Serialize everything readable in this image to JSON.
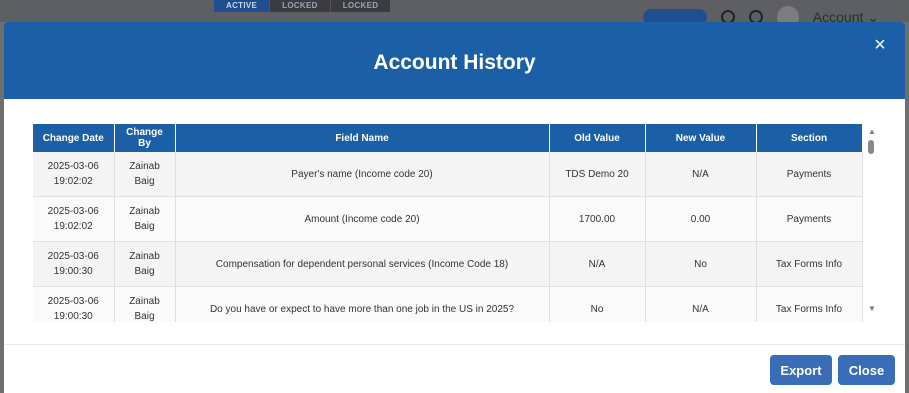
{
  "background": {
    "tabs": [
      "ACTIVE",
      "LOCKED",
      "LOCKED"
    ],
    "account_label": "Account"
  },
  "modal": {
    "title": "Account History",
    "close_icon": "×",
    "export_label": "Export",
    "close_label": "Close"
  },
  "table": {
    "columns": [
      "Change Date",
      "Change By",
      "Field Name",
      "Old Value",
      "New Value",
      "Section"
    ],
    "rows": [
      {
        "date": "2025-03-06",
        "time": "19:02:02",
        "by_first": "Zainab",
        "by_last": "Baig",
        "field": "Payer's name (Income code 20)",
        "old": "TDS Demo 20",
        "new": "N/A",
        "section": "Payments"
      },
      {
        "date": "2025-03-06",
        "time": "19:02:02",
        "by_first": "Zainab",
        "by_last": "Baig",
        "field": "Amount (Income code 20)",
        "old": "1700.00",
        "new": "0.00",
        "section": "Payments"
      },
      {
        "date": "2025-03-06",
        "time": "19:00:30",
        "by_first": "Zainab",
        "by_last": "Baig",
        "field": "Compensation for dependent personal services (Income Code 18)",
        "old": "N/A",
        "new": "No",
        "section": "Tax Forms Info"
      },
      {
        "date": "2025-03-06",
        "time": "19:00:30",
        "by_first": "Zainab",
        "by_last": "Baig",
        "field": "Do you have or expect to have more than one job in the US in 2025?",
        "old": "No",
        "new": "N/A",
        "section": "Tax Forms Info"
      }
    ]
  },
  "colors": {
    "header_blue": "#1b5fa6",
    "button_blue": "#3a6db8"
  }
}
